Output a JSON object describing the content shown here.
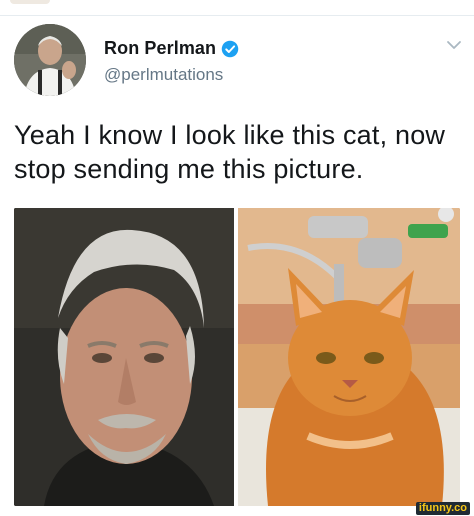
{
  "tweet": {
    "author_name": "Ron Perlman",
    "handle": "@perlmutations",
    "text": "Yeah I know I look like this cat, now stop sending me this picture."
  },
  "icons": {
    "verified": "verified-badge-icon",
    "menu": "chevron-down-icon"
  },
  "colors": {
    "verified_blue": "#1da1f2",
    "text": "#14171a",
    "secondary_text": "#657786",
    "watermark_bg": "#1f2a33",
    "watermark_fg": "#f5c518"
  },
  "watermark": {
    "label": "ifunny.co"
  }
}
